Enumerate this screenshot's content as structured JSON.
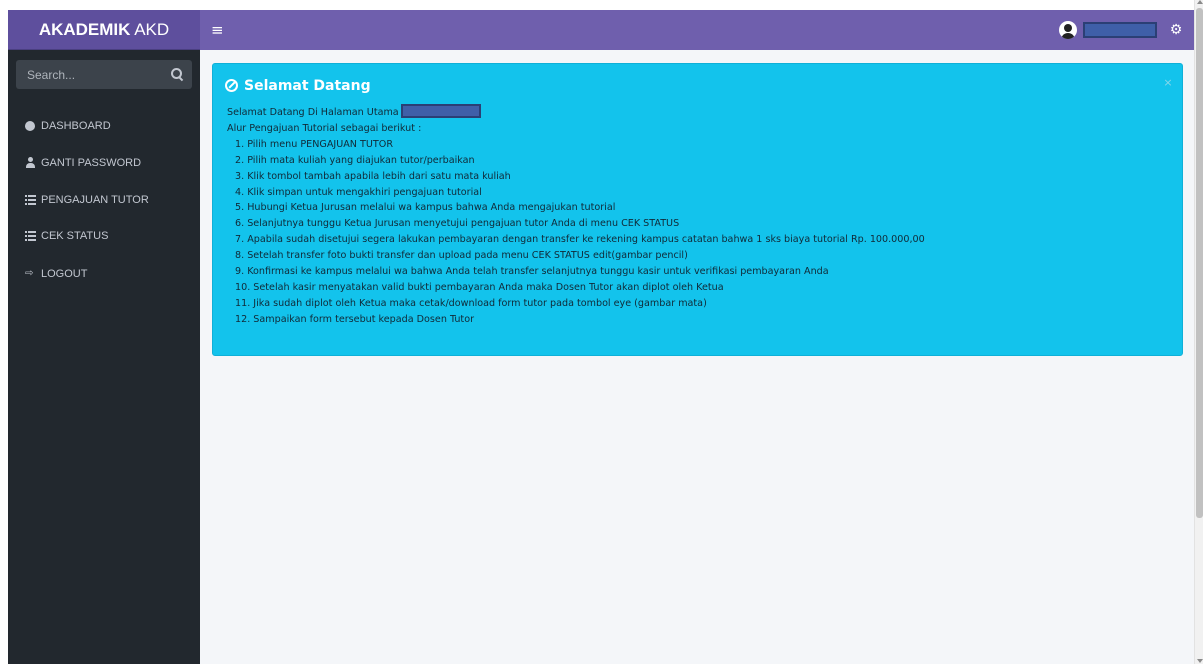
{
  "navbar": {
    "brand_bold": "AKADEMIK",
    "brand_rest": " AKD",
    "menu_icon": "bars-icon",
    "user_icon": "user-circle-icon",
    "settings_icon": "cogs-icon",
    "color": "#6f5fad"
  },
  "sidebar": {
    "search_placeholder": "Search...",
    "items": [
      {
        "label": "DASHBOARD",
        "icon": "circle-icon"
      },
      {
        "label": "GANTI PASSWORD",
        "icon": "user-icon"
      },
      {
        "label": "PENGAJUAN TUTOR",
        "icon": "list-icon"
      },
      {
        "label": "CEK STATUS",
        "icon": "list-icon"
      },
      {
        "label": "LOGOUT",
        "icon": "sign-in-icon"
      }
    ]
  },
  "alert": {
    "title": "Selamat Datang",
    "close": "×",
    "intro": "Selamat Datang Di Halaman Utama",
    "subtitle": "Alur Pengajuan Tutorial sebagai berikut :",
    "steps": [
      "1. Pilih menu PENGAJUAN TUTOR",
      "2. Pilih mata kuliah yang diajukan tutor/perbaikan",
      "3. Klik tombol tambah apabila lebih dari satu mata kuliah",
      "4. Klik simpan untuk mengakhiri pengajuan tutorial",
      "5. Hubungi Ketua Jurusan melalui wa kampus bahwa Anda mengajukan tutorial",
      "6. Selanjutnya tunggu Ketua Jurusan menyetujui pengajuan tutor Anda di menu CEK STATUS",
      "7. Apabila sudah disetujui segera lakukan pembayaran dengan transfer ke rekening kampus catatan bahwa 1 sks biaya tutorial Rp. 100.000,00",
      "8. Setelah transfer foto bukti transfer dan upload pada menu CEK STATUS edit(gambar pencil)",
      "9. Konfirmasi ke kampus melalui wa bahwa Anda telah transfer selanjutnya tunggu kasir untuk verifikasi pembayaran Anda",
      "10. Setelah kasir menyatakan valid bukti pembayaran Anda maka Dosen Tutor akan diplot oleh Ketua",
      "11. Jika sudah diplot oleh Ketua maka cetak/download form tutor pada tombol eye (gambar mata)",
      "12. Sampaikan form tersebut kepada Dosen Tutor"
    ],
    "color": "#13c3ec"
  }
}
